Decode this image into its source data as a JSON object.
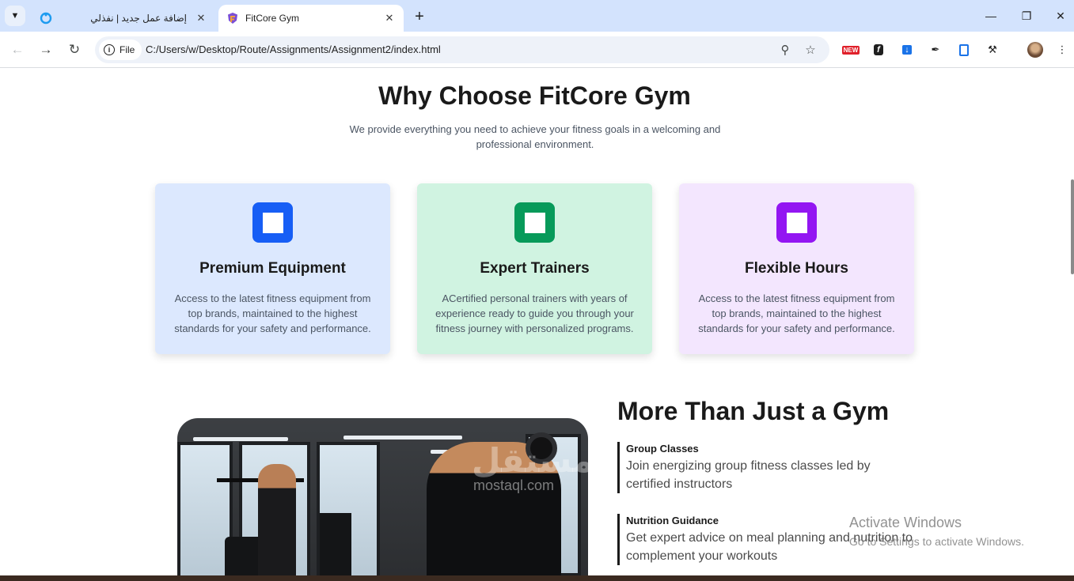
{
  "browser": {
    "tabs": [
      {
        "title": "إضافة عمل جديد | نفذلي",
        "active": false,
        "favicon": "nafzly-icon"
      },
      {
        "title": "FitCore Gym",
        "active": true,
        "favicon": "fitcore-shield-icon"
      }
    ],
    "address": {
      "scheme_label": "File",
      "url": "C:/Users/w/Desktop/Route/Assignments/Assignment2/index.html"
    },
    "extension_badge": "NEW"
  },
  "why": {
    "title": "Why Choose FitCore Gym",
    "subtitle": "We provide everything you need to achieve your fitness goals in a welcoming and professional environment.",
    "cards": [
      {
        "title": "Premium Equipment",
        "text": "Access to the latest fitness equipment from top brands, maintained to the highest standards for your safety and performance.",
        "bg": "#dce8fe",
        "accent": "#175ef5"
      },
      {
        "title": "Expert Trainers",
        "text": "ACertified personal trainers with years of experience ready to guide you through your fitness journey with personalized programs.",
        "bg": "#d0f3e1",
        "accent": "#079a5a"
      },
      {
        "title": "Flexible Hours",
        "text": "Access to the latest fitness equipment from top brands, maintained to the highest standards for your safety and performance.",
        "bg": "#f3e6fe",
        "accent": "#9316f2"
      }
    ]
  },
  "more": {
    "title": "More Than Just a Gym",
    "features": [
      {
        "title": "Group Classes",
        "text": "Join energizing group fitness classes led by certified instructors"
      },
      {
        "title": "Nutrition Guidance",
        "text": "Get expert advice on meal planning and nutrition to complement your workouts"
      }
    ]
  },
  "overlay": {
    "watermark": "مستقل",
    "watermark_sub": "mostaql.com",
    "activate_title": "Activate Windows",
    "activate_sub": "Go to Settings to activate Windows."
  }
}
